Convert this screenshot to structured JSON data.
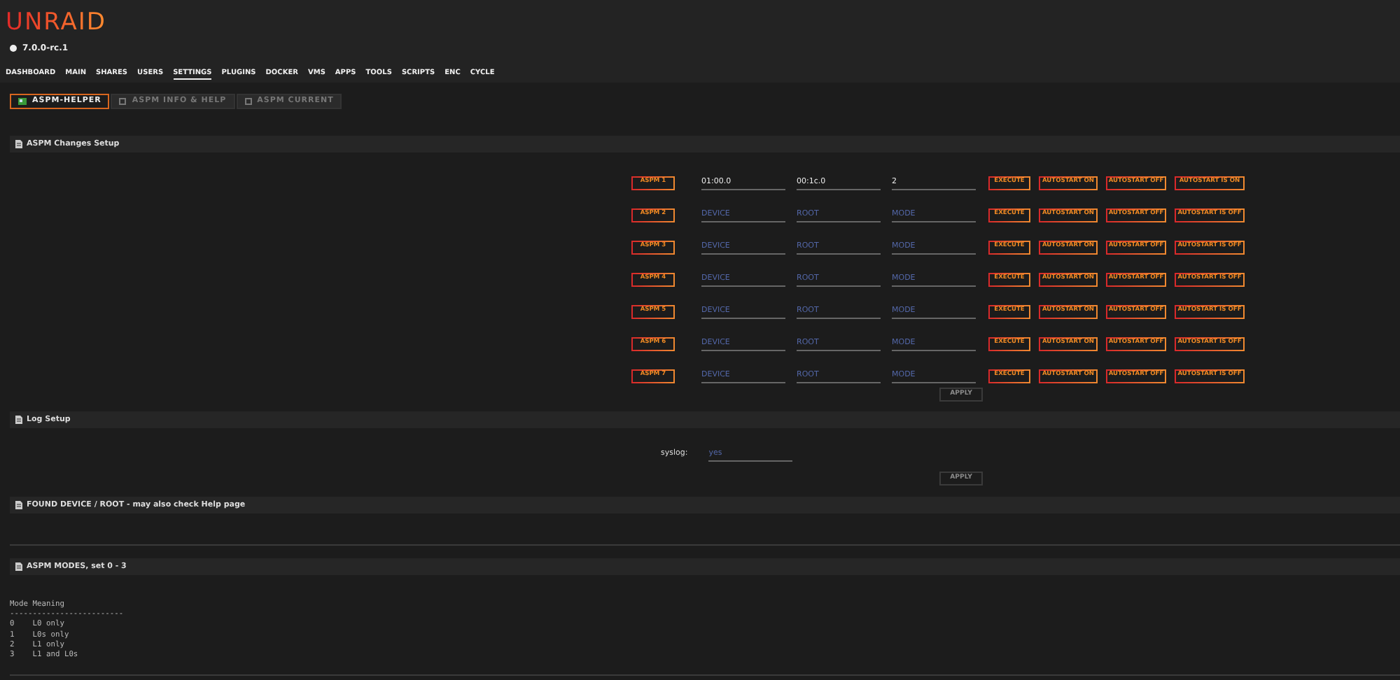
{
  "header": {
    "logo": "UNRAID",
    "version": "7.0.0-rc.1"
  },
  "nav": [
    {
      "label": "DASHBOARD",
      "selected": false
    },
    {
      "label": "MAIN",
      "selected": false
    },
    {
      "label": "SHARES",
      "selected": false
    },
    {
      "label": "USERS",
      "selected": false
    },
    {
      "label": "SETTINGS",
      "selected": true
    },
    {
      "label": "PLUGINS",
      "selected": false
    },
    {
      "label": "DOCKER",
      "selected": false
    },
    {
      "label": "VMS",
      "selected": false
    },
    {
      "label": "APPS",
      "selected": false
    },
    {
      "label": "TOOLS",
      "selected": false
    },
    {
      "label": "SCRIPTS",
      "selected": false
    },
    {
      "label": "ENC",
      "selected": false
    },
    {
      "label": "CYCLE",
      "selected": false
    }
  ],
  "tabs": [
    {
      "label": "ASPM-HELPER",
      "selected": true
    },
    {
      "label": "ASPM INFO & HELP",
      "selected": false
    },
    {
      "label": "ASPM CURRENT",
      "selected": false
    }
  ],
  "changes_section": {
    "title": "ASPM Changes Setup",
    "rows": [
      {
        "label": "ASPM 1",
        "device": {
          "value": "01:00.0"
        },
        "root": {
          "value": "00:1c.0"
        },
        "mode": {
          "value": "2"
        },
        "execute": "EXECUTE",
        "autostart_on": "AUTOSTART ON",
        "autostart_off": "AUTOSTART OFF",
        "status": "AUTOSTART IS ON"
      },
      {
        "label": "ASPM 2",
        "device": {
          "placeholder": "DEVICE"
        },
        "root": {
          "placeholder": "ROOT"
        },
        "mode": {
          "placeholder": "MODE"
        },
        "execute": "EXECUTE",
        "autostart_on": "AUTOSTART ON",
        "autostart_off": "AUTOSTART OFF",
        "status": "AUTOSTART IS OFF"
      },
      {
        "label": "ASPM 3",
        "device": {
          "placeholder": "DEVICE"
        },
        "root": {
          "placeholder": "ROOT"
        },
        "mode": {
          "placeholder": "MODE"
        },
        "execute": "EXECUTE",
        "autostart_on": "AUTOSTART ON",
        "autostart_off": "AUTOSTART OFF",
        "status": "AUTOSTART IS OFF"
      },
      {
        "label": "ASPM 4",
        "device": {
          "placeholder": "DEVICE"
        },
        "root": {
          "placeholder": "ROOT"
        },
        "mode": {
          "placeholder": "MODE"
        },
        "execute": "EXECUTE",
        "autostart_on": "AUTOSTART ON",
        "autostart_off": "AUTOSTART OFF",
        "status": "AUTOSTART IS OFF"
      },
      {
        "label": "ASPM 5",
        "device": {
          "placeholder": "DEVICE"
        },
        "root": {
          "placeholder": "ROOT"
        },
        "mode": {
          "placeholder": "MODE"
        },
        "execute": "EXECUTE",
        "autostart_on": "AUTOSTART ON",
        "autostart_off": "AUTOSTART OFF",
        "status": "AUTOSTART IS OFF"
      },
      {
        "label": "ASPM 6",
        "device": {
          "placeholder": "DEVICE"
        },
        "root": {
          "placeholder": "ROOT"
        },
        "mode": {
          "placeholder": "MODE"
        },
        "execute": "EXECUTE",
        "autostart_on": "AUTOSTART ON",
        "autostart_off": "AUTOSTART OFF",
        "status": "AUTOSTART IS OFF"
      },
      {
        "label": "ASPM 7",
        "device": {
          "placeholder": "DEVICE"
        },
        "root": {
          "placeholder": "ROOT"
        },
        "mode": {
          "placeholder": "MODE"
        },
        "execute": "EXECUTE",
        "autostart_on": "AUTOSTART ON",
        "autostart_off": "AUTOSTART OFF",
        "status": "AUTOSTART IS OFF"
      }
    ],
    "apply": {
      "label": "APPLY",
      "disabled": true
    }
  },
  "log_section": {
    "title": "Log Setup",
    "label": "syslog:",
    "field": {
      "placeholder": "yes"
    },
    "apply": {
      "label": "APPLY",
      "disabled": true
    }
  },
  "found_section": {
    "title": "FOUND DEVICE / ROOT - may also check Help page"
  },
  "modes_section": {
    "title": "ASPM MODES, set 0 - 3",
    "lines": [
      "Mode Meaning",
      "-------------------------",
      "0    L0 only",
      "1    L0s only",
      "2    L1 only",
      "3    L1 and L0s"
    ]
  }
}
